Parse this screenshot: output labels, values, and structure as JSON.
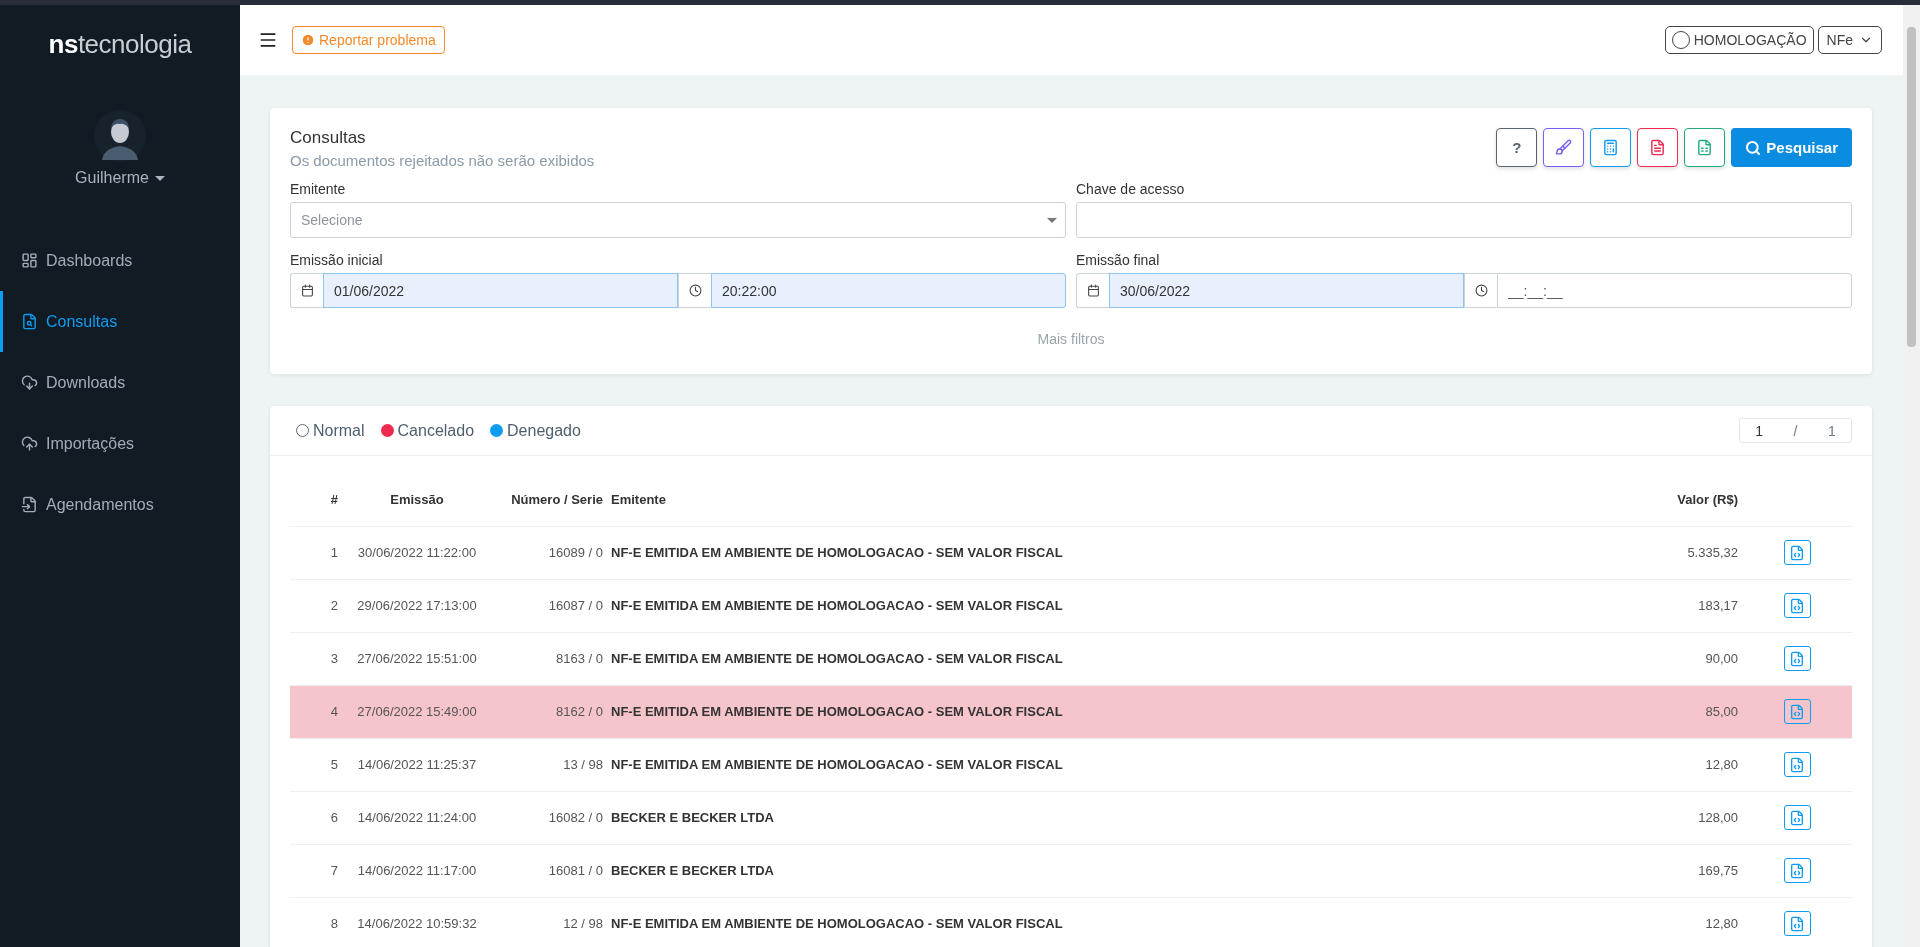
{
  "sidebar": {
    "logo_bold": "ns",
    "logo_light": "tecnologia",
    "user": "Guilherme",
    "items": [
      {
        "label": "Dashboards",
        "selected": false
      },
      {
        "label": "Consultas",
        "selected": true
      },
      {
        "label": "Downloads",
        "selected": false
      },
      {
        "label": "Importações",
        "selected": false
      },
      {
        "label": "Agendamentos",
        "selected": false
      }
    ]
  },
  "header": {
    "report_button": "Reportar problema",
    "environment": {
      "label": "HOMOLOGAÇÃO",
      "on": false
    },
    "document_type": "NFe"
  },
  "filters": {
    "title": "Consultas",
    "subtitle": "Os documentos rejeitados não serão exibidos",
    "toolbar": [
      {
        "kind": "help",
        "label": "?"
      },
      {
        "kind": "clear"
      },
      {
        "kind": "calculator"
      },
      {
        "kind": "pdf"
      },
      {
        "kind": "excel"
      }
    ],
    "search_button": "Pesquisar",
    "emitente": {
      "label": "Emitente",
      "placeholder": "Selecione"
    },
    "chave": {
      "label": "Chave de acesso"
    },
    "emissao_inicial": {
      "label": "Emissão inicial",
      "date": "01/06/2022",
      "time": "20:22:00"
    },
    "emissao_final": {
      "label": "Emissão final",
      "date": "30/06/2022",
      "time_placeholder": "__:__:__"
    },
    "more": "Mais filtros"
  },
  "legend": [
    {
      "label": "Normal",
      "kind": "outline",
      "color": "#5a6a7e"
    },
    {
      "label": "Cancelado",
      "kind": "filled",
      "color": "#f0294f"
    },
    {
      "label": "Denegado",
      "kind": "filled",
      "color": "#0d9cf2"
    }
  ],
  "pagination": {
    "current": "1",
    "separator": "/",
    "total": "1"
  },
  "table": {
    "columns": [
      "#",
      "Emissão",
      "Número / Serie",
      "Emitente",
      "Valor (R$)"
    ],
    "rows": [
      {
        "n": "1",
        "emissao": "30/06/2022 11:22:00",
        "numero": "16089 / 0",
        "emitente": "NF-E EMITIDA EM AMBIENTE DE HOMOLOGACAO - SEM VALOR FISCAL",
        "valor": "5.335,32",
        "cancelled": false
      },
      {
        "n": "2",
        "emissao": "29/06/2022 17:13:00",
        "numero": "16087 / 0",
        "emitente": "NF-E EMITIDA EM AMBIENTE DE HOMOLOGACAO - SEM VALOR FISCAL",
        "valor": "183,17",
        "cancelled": false
      },
      {
        "n": "3",
        "emissao": "27/06/2022 15:51:00",
        "numero": "8163 / 0",
        "emitente": "NF-E EMITIDA EM AMBIENTE DE HOMOLOGACAO - SEM VALOR FISCAL",
        "valor": "90,00",
        "cancelled": false
      },
      {
        "n": "4",
        "emissao": "27/06/2022 15:49:00",
        "numero": "8162 / 0",
        "emitente": "NF-E EMITIDA EM AMBIENTE DE HOMOLOGACAO - SEM VALOR FISCAL",
        "valor": "85,00",
        "cancelled": true
      },
      {
        "n": "5",
        "emissao": "14/06/2022 11:25:37",
        "numero": "13 / 98",
        "emitente": "NF-E EMITIDA EM AMBIENTE DE HOMOLOGACAO - SEM VALOR FISCAL",
        "valor": "12,80",
        "cancelled": false
      },
      {
        "n": "6",
        "emissao": "14/06/2022 11:24:00",
        "numero": "16082 / 0",
        "emitente": "BECKER E BECKER LTDA",
        "valor": "128,00",
        "cancelled": false
      },
      {
        "n": "7",
        "emissao": "14/06/2022 11:17:00",
        "numero": "16081 / 0",
        "emitente": "BECKER E BECKER LTDA",
        "valor": "169,75",
        "cancelled": false
      },
      {
        "n": "8",
        "emissao": "14/06/2022 10:59:32",
        "numero": "12 / 98",
        "emitente": "NF-E EMITIDA EM AMBIENTE DE HOMOLOGACAO - SEM VALOR FISCAL",
        "valor": "12,80",
        "cancelled": false
      }
    ]
  }
}
